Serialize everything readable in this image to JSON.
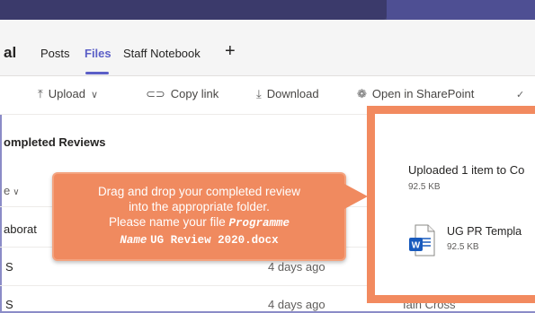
{
  "header": {
    "team_name": "al",
    "tabs": [
      {
        "label": "Posts"
      },
      {
        "label": "Files"
      },
      {
        "label": "Staff Notebook"
      }
    ],
    "add_tab": "+"
  },
  "toolbar": {
    "upload": "Upload",
    "copy_link": "Copy link",
    "download": "Download",
    "open_sharepoint": "Open in SharePoint",
    "more": "✓"
  },
  "files": {
    "section_title": "ompleted Reviews",
    "column_header": "e",
    "rows": [
      {
        "name": "aborat",
        "modified": "",
        "by": ""
      },
      {
        "name": "S",
        "modified": "4 days ago",
        "by": ""
      },
      {
        "name": "S",
        "modified": "4 days ago",
        "by": "Iain Cross"
      }
    ]
  },
  "callout": {
    "line1": "Drag and drop your completed review",
    "line2": "into the appropriate folder.",
    "line3_prefix": "Please name your file ",
    "line3_mono": "Programme",
    "line4_mono_italic": "Name",
    "line4_mono": "UG Review 2020.docx"
  },
  "upload_panel": {
    "title": "Uploaded 1 item to Co",
    "size": "92.5 KB",
    "file_name": "UG PR Templa",
    "file_size": "92.5 KB"
  },
  "colors": {
    "accent": "#5b5fc7",
    "callout": "#f08a5f",
    "panel_border": "#f28a5f",
    "word_blue": "#185abd"
  },
  "icons": {
    "upload": "upload-arrow-icon",
    "copy_link": "link-icon",
    "download": "download-arrow-icon",
    "sharepoint": "sharepoint-icon",
    "word": "word-document-icon"
  }
}
